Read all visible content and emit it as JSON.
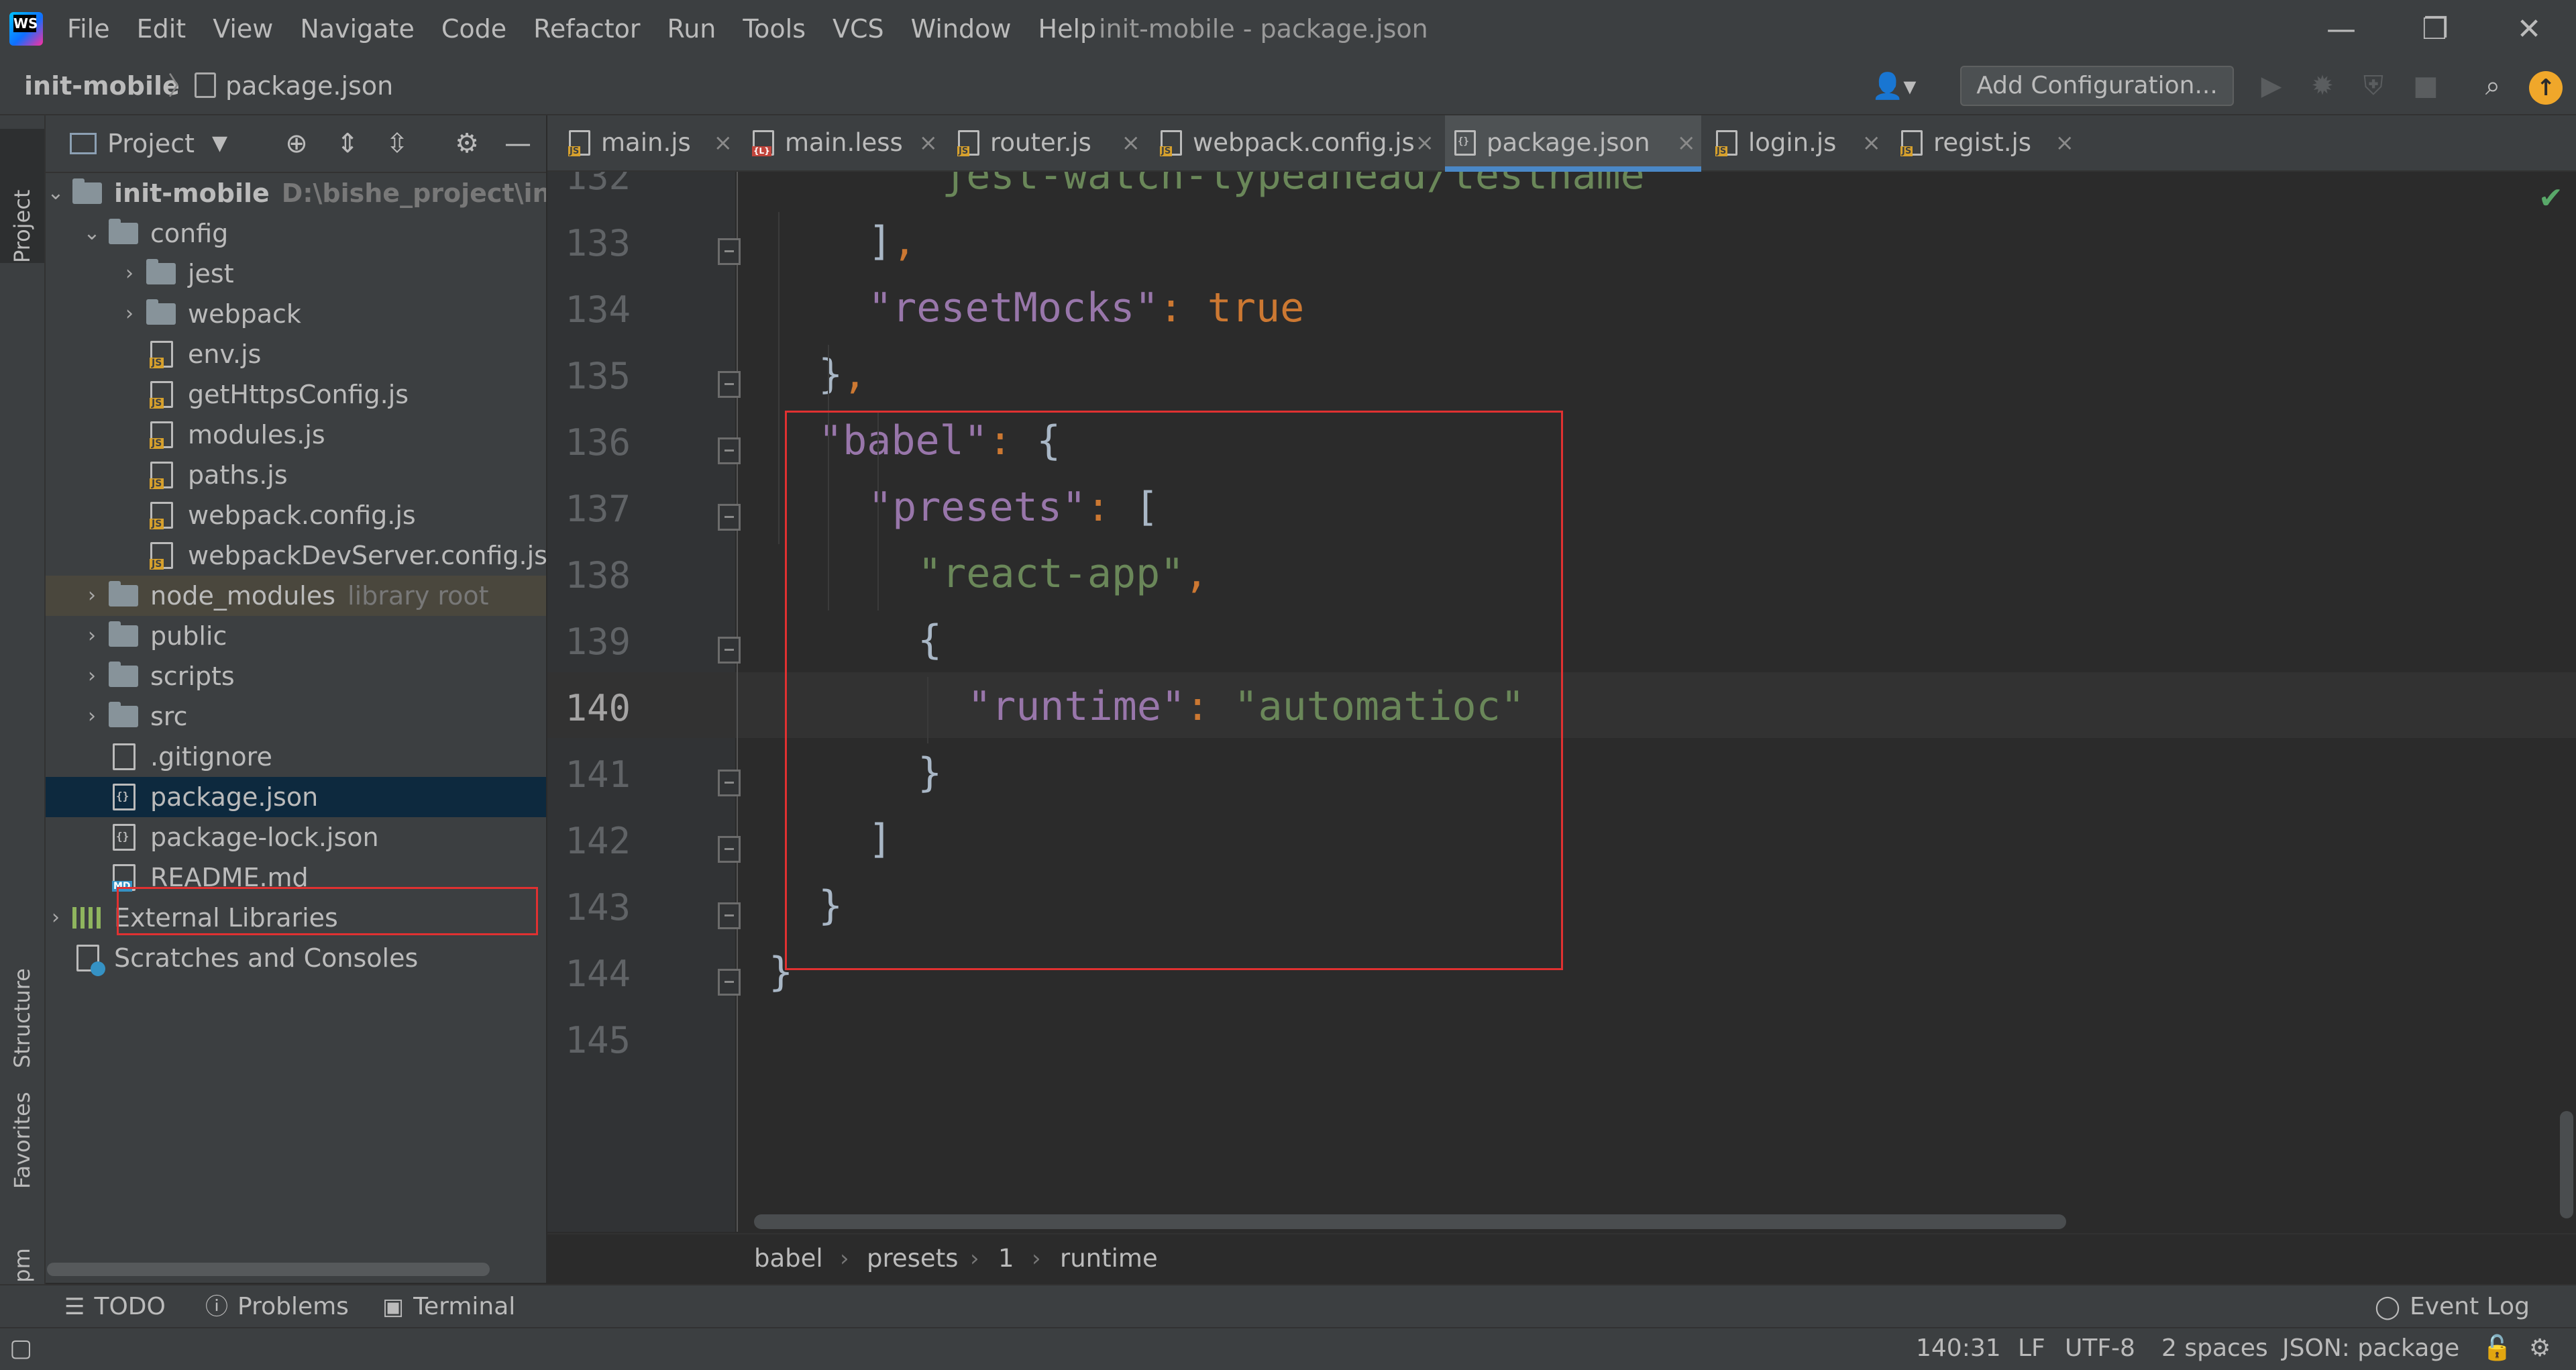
{
  "window": {
    "title": "init-mobile - package.json",
    "menu": [
      "File",
      "Edit",
      "View",
      "Navigate",
      "Code",
      "Refactor",
      "Run",
      "Tools",
      "VCS",
      "Window",
      "Help"
    ],
    "minimize_glyph": "—",
    "restore_glyph": "❐",
    "close_glyph": "✕"
  },
  "navbar": {
    "project": "init-mobile",
    "separator": "〉",
    "file": "package.json",
    "add_configuration": "Add Configuration..."
  },
  "left_strip": {
    "project": "Project",
    "structure": "Structure",
    "favorites": "Favorites",
    "npm": "npm"
  },
  "project_panel": {
    "title": "Project",
    "tree": [
      {
        "label": "init-mobile",
        "hint": "D:\\bishe_project\\init-m",
        "depth": 0,
        "kind": "folder",
        "arrow": "⌄",
        "bold": true
      },
      {
        "label": "config",
        "hint": "",
        "depth": 1,
        "kind": "folder",
        "arrow": "⌄"
      },
      {
        "label": "jest",
        "hint": "",
        "depth": 2,
        "kind": "folder",
        "arrow": "›"
      },
      {
        "label": "webpack",
        "hint": "",
        "depth": 2,
        "kind": "folder",
        "arrow": "›"
      },
      {
        "label": "env.js",
        "hint": "",
        "depth": 2,
        "kind": "js",
        "arrow": ""
      },
      {
        "label": "getHttpsConfig.js",
        "hint": "",
        "depth": 2,
        "kind": "js",
        "arrow": ""
      },
      {
        "label": "modules.js",
        "hint": "",
        "depth": 2,
        "kind": "js",
        "arrow": ""
      },
      {
        "label": "paths.js",
        "hint": "",
        "depth": 2,
        "kind": "js",
        "arrow": ""
      },
      {
        "label": "webpack.config.js",
        "hint": "",
        "depth": 2,
        "kind": "js",
        "arrow": ""
      },
      {
        "label": "webpackDevServer.config.js",
        "hint": "",
        "depth": 2,
        "kind": "js",
        "arrow": ""
      },
      {
        "label": "node_modules",
        "hint": "library root",
        "depth": 1,
        "kind": "folder",
        "arrow": "›",
        "libroot": true
      },
      {
        "label": "public",
        "hint": "",
        "depth": 1,
        "kind": "folder",
        "arrow": "›"
      },
      {
        "label": "scripts",
        "hint": "",
        "depth": 1,
        "kind": "folder",
        "arrow": "›"
      },
      {
        "label": "src",
        "hint": "",
        "depth": 1,
        "kind": "folder",
        "arrow": "›"
      },
      {
        "label": ".gitignore",
        "hint": "",
        "depth": 1,
        "kind": "git",
        "arrow": ""
      },
      {
        "label": "package.json",
        "hint": "",
        "depth": 1,
        "kind": "json",
        "arrow": "",
        "selected": true
      },
      {
        "label": "package-lock.json",
        "hint": "",
        "depth": 1,
        "kind": "json",
        "arrow": ""
      },
      {
        "label": "README.md",
        "hint": "",
        "depth": 1,
        "kind": "md",
        "arrow": ""
      },
      {
        "label": "External Libraries",
        "hint": "",
        "depth": 0,
        "kind": "extlib",
        "arrow": "›"
      },
      {
        "label": "Scratches and Consoles",
        "hint": "",
        "depth": 0,
        "kind": "scratch",
        "arrow": ""
      }
    ]
  },
  "editor": {
    "tabs": [
      {
        "name": "main.js",
        "type": "js",
        "active": false
      },
      {
        "name": "main.less",
        "type": "less",
        "active": false
      },
      {
        "name": "router.js",
        "type": "js",
        "active": false
      },
      {
        "name": "webpack.config.js",
        "type": "js",
        "active": false
      },
      {
        "name": "package.json",
        "type": "json",
        "active": true
      },
      {
        "name": "login.js",
        "type": "js",
        "active": false
      },
      {
        "name": "regist.js",
        "type": "js",
        "active": false
      }
    ],
    "tab_close_glyph": "×",
    "lines": [
      {
        "n": "132",
        "indent": 3,
        "tokens": [
          [
            "s",
            "\"jest-watch-typeahead/testname\""
          ]
        ]
      },
      {
        "n": "133",
        "indent": 2,
        "tokens": [
          [
            "g",
            "]"
          ],
          [
            "p",
            ","
          ]
        ]
      },
      {
        "n": "134",
        "indent": 2,
        "tokens": [
          [
            "k",
            "\"resetMocks\""
          ],
          [
            "p",
            ": "
          ],
          [
            "b",
            "true"
          ]
        ]
      },
      {
        "n": "135",
        "indent": 1,
        "tokens": [
          [
            "g",
            "}"
          ],
          [
            "p",
            ","
          ]
        ]
      },
      {
        "n": "136",
        "indent": 1,
        "tokens": [
          [
            "k",
            "\"babel\""
          ],
          [
            "p",
            ": "
          ],
          [
            "g",
            "{"
          ]
        ]
      },
      {
        "n": "137",
        "indent": 2,
        "tokens": [
          [
            "k",
            "\"presets\""
          ],
          [
            "p",
            ": "
          ],
          [
            "g",
            "["
          ]
        ]
      },
      {
        "n": "138",
        "indent": 3,
        "tokens": [
          [
            "s",
            "\"react-app\""
          ],
          [
            "p",
            ","
          ]
        ]
      },
      {
        "n": "139",
        "indent": 3,
        "tokens": [
          [
            "g",
            "{"
          ]
        ]
      },
      {
        "n": "140",
        "indent": 4,
        "tokens": [
          [
            "k",
            "\"runtime\""
          ],
          [
            "p",
            ": "
          ],
          [
            "s",
            "\"automatioc\""
          ]
        ]
      },
      {
        "n": "141",
        "indent": 3,
        "tokens": [
          [
            "g",
            "}"
          ]
        ]
      },
      {
        "n": "142",
        "indent": 2,
        "tokens": [
          [
            "g",
            "]"
          ]
        ]
      },
      {
        "n": "143",
        "indent": 1,
        "tokens": [
          [
            "g",
            "}"
          ]
        ]
      },
      {
        "n": "144",
        "indent": 0,
        "tokens": [
          [
            "g",
            "}"
          ]
        ]
      },
      {
        "n": "145",
        "indent": 0,
        "tokens": []
      }
    ],
    "current_line": "140",
    "breadcrumb": [
      "babel",
      "presets",
      "1",
      "runtime"
    ]
  },
  "bottom_tools": {
    "todo": "TODO",
    "problems": "Problems",
    "terminal": "Terminal",
    "event_log": "Event Log"
  },
  "status": {
    "position": "140:31",
    "line_separator": "LF",
    "encoding": "UTF-8",
    "indent": "2 spaces",
    "schema": "JSON: package"
  },
  "colors": {
    "background": "#2b2b2b",
    "panel": "#3c3f41",
    "json_key": "#9876aa",
    "json_string": "#6a8759",
    "punctuation": "#cc7832",
    "highlight_box": "#e03131",
    "active_tab_underline": "#4a88c7"
  },
  "icons": [
    "webstorm-logo-icon",
    "user-icon",
    "run-icon",
    "debug-icon",
    "coverage-icon",
    "stop-icon",
    "search-icon",
    "update-icon",
    "locate-icon",
    "expand-all-icon",
    "collapse-all-icon",
    "gear-icon",
    "minimize-panel-icon",
    "check-icon",
    "lock-icon",
    "inspector-icon"
  ]
}
